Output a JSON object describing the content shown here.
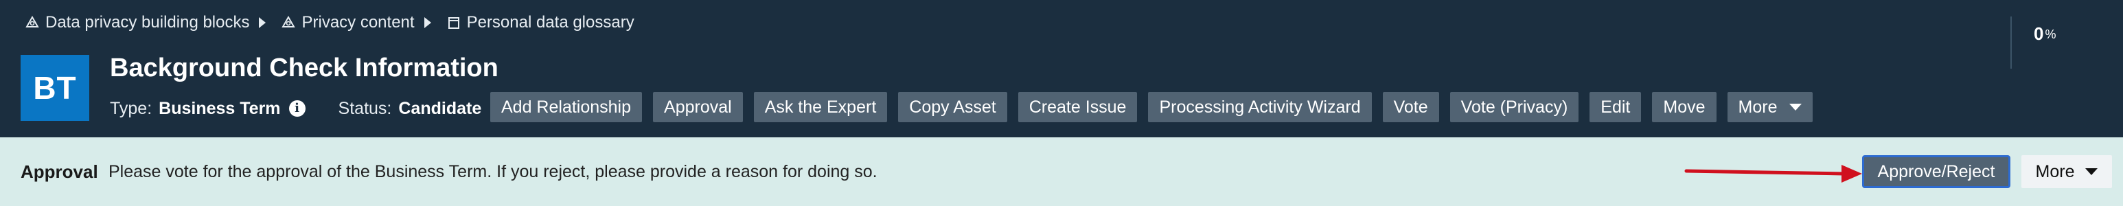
{
  "breadcrumb": [
    {
      "label": "Data privacy building blocks",
      "icon": "community-icon"
    },
    {
      "label": "Privacy content",
      "icon": "community-icon"
    },
    {
      "label": "Personal data glossary",
      "icon": "glossary-icon"
    }
  ],
  "progress": {
    "value": "0",
    "unit": "%"
  },
  "asset": {
    "avatar": "BT",
    "title": "Background Check Information",
    "type_label": "Type:",
    "type_value": "Business Term",
    "status_label": "Status:",
    "status_value": "Candidate"
  },
  "actions": [
    "Add Relationship",
    "Approval",
    "Ask the Expert",
    "Copy Asset",
    "Create Issue",
    "Processing Activity Wizard",
    "Vote",
    "Vote (Privacy)",
    "Edit",
    "Move",
    "More"
  ],
  "banner": {
    "label": "Approval",
    "text": "Please vote for the approval of the Business Term. If you reject, please provide a reason for doing so.",
    "approve_label": "Approve/Reject",
    "more_label": "More"
  },
  "colors": {
    "header_bg": "#1b2e3f",
    "avatar_bg": "#0a76c4",
    "button_bg": "#516373",
    "banner_bg": "#d8ecea",
    "arrow": "#d0101e",
    "focus_border": "#2d6bd1"
  }
}
